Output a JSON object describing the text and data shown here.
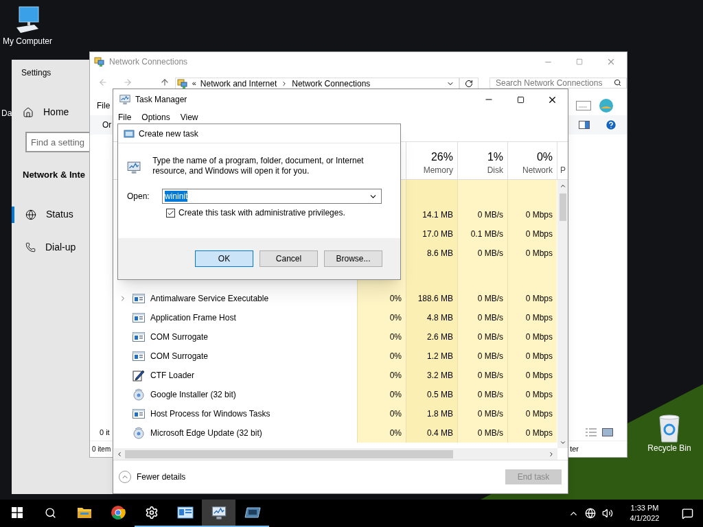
{
  "desktop_icons": [
    {
      "label": "My Computer",
      "kind": "computer"
    },
    {
      "label": "Da",
      "kind": "partial"
    },
    {
      "label": "Recycle Bin",
      "kind": "recycle"
    }
  ],
  "settings_window": {
    "title": "Settings",
    "home": "Home",
    "search": {
      "placeholder": "Find a setting"
    },
    "section": "Network & Inte",
    "items": [
      {
        "label": "Status",
        "kind": "globe",
        "selected": true
      },
      {
        "label": "Dial-up",
        "kind": "phone",
        "selected": false
      }
    ]
  },
  "network_connections": {
    "title": "Network Connections",
    "address_prefix": "«",
    "breadcrumb": [
      "Network and Internet",
      "Network Connections"
    ],
    "search": {
      "placeholder": "Search Network Connections"
    },
    "menu_item": "File",
    "toolbar_label": "Or",
    "status_line": "0 it",
    "status_bar": "0 item",
    "status_right": "ter"
  },
  "task_manager": {
    "title": "Task Manager",
    "menu": [
      "File",
      "Options",
      "View"
    ],
    "columns": [
      {
        "percent": "26%",
        "label": "Memory"
      },
      {
        "percent": "1%",
        "label": "Disk"
      },
      {
        "percent": "0%",
        "label": "Network"
      }
    ],
    "column_5": "P",
    "app_rows": [
      {
        "memory": "14.1 MB",
        "disk": "0 MB/s",
        "network": "0 Mbps"
      },
      {
        "memory": "17.0 MB",
        "disk": "0.1 MB/s",
        "network": "0 Mbps"
      },
      {
        "memory": "8.6 MB",
        "disk": "0 MB/s",
        "network": "0 Mbps"
      }
    ],
    "background_rows": [
      {
        "name": "Antimalware Service Executable",
        "kind": "window",
        "expandable": true,
        "cpu": "0%",
        "memory": "188.6 MB",
        "disk": "0 MB/s",
        "network": "0 Mbps"
      },
      {
        "name": "Application Frame Host",
        "kind": "window",
        "expandable": false,
        "cpu": "0%",
        "memory": "4.8 MB",
        "disk": "0 MB/s",
        "network": "0 Mbps"
      },
      {
        "name": "COM Surrogate",
        "kind": "window",
        "expandable": false,
        "cpu": "0%",
        "memory": "2.6 MB",
        "disk": "0 MB/s",
        "network": "0 Mbps"
      },
      {
        "name": "COM Surrogate",
        "kind": "window",
        "expandable": false,
        "cpu": "0%",
        "memory": "1.2 MB",
        "disk": "0 MB/s",
        "network": "0 Mbps"
      },
      {
        "name": "CTF Loader",
        "kind": "pen",
        "expandable": false,
        "cpu": "0%",
        "memory": "3.2 MB",
        "disk": "0 MB/s",
        "network": "0 Mbps"
      },
      {
        "name": "Google Installer (32 bit)",
        "kind": "installer",
        "expandable": false,
        "cpu": "0%",
        "memory": "0.5 MB",
        "disk": "0 MB/s",
        "network": "0 Mbps"
      },
      {
        "name": "Host Process for Windows Tasks",
        "kind": "window",
        "expandable": false,
        "cpu": "0%",
        "memory": "1.8 MB",
        "disk": "0 MB/s",
        "network": "0 Mbps"
      },
      {
        "name": "Microsoft Edge Update (32 bit)",
        "kind": "installer",
        "expandable": false,
        "cpu": "0%",
        "memory": "0.4 MB",
        "disk": "0 MB/s",
        "network": "0 Mbps"
      }
    ],
    "footer": {
      "label": "Fewer details",
      "end_task": {
        "label": "End task",
        "disabled": true
      }
    }
  },
  "dialog": {
    "title": "Create new task",
    "message": "Type the name of a program, folder, document, or Internet resource, and Windows will open it for you.",
    "open_label": "Open:",
    "open_value": "wininit",
    "checkbox": {
      "label": "Create this task with administrative privileges.",
      "checked": true
    },
    "buttons": [
      {
        "label": "OK",
        "default": true
      },
      {
        "label": "Cancel",
        "default": false
      },
      {
        "label": "Browse...",
        "default": false
      }
    ]
  },
  "taskbar": {
    "apps": [
      {
        "kind": "start",
        "running": false,
        "selected": false
      },
      {
        "kind": "search",
        "running": false,
        "selected": false
      },
      {
        "kind": "folder",
        "running": false,
        "selected": false
      },
      {
        "kind": "chrome",
        "running": false,
        "selected": false
      },
      {
        "kind": "gear",
        "running": true,
        "selected": false
      },
      {
        "kind": "control-panel",
        "running": true,
        "selected": false
      },
      {
        "kind": "task-manager",
        "running": true,
        "selected": true
      },
      {
        "kind": "window-app",
        "running": true,
        "selected": false
      }
    ],
    "time": "1:33 PM",
    "date": "4/1/2022"
  }
}
